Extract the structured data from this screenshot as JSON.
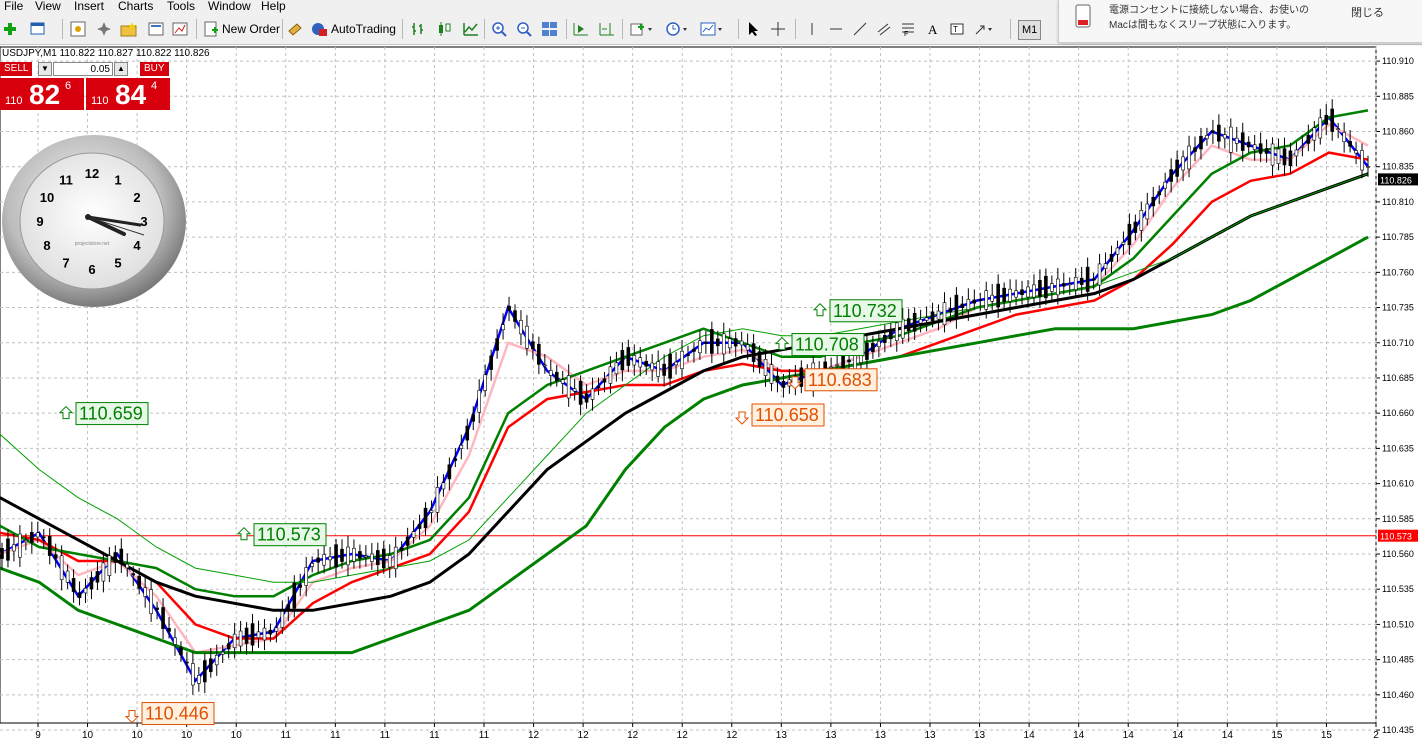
{
  "menu": [
    "File",
    "View",
    "Insert",
    "Charts",
    "Tools",
    "Window",
    "Help"
  ],
  "toolbar": {
    "new_order_label": "New Order",
    "autotrading_label": "AutoTrading",
    "timeframe_label": "M1"
  },
  "notification": {
    "line1": "電源コンセントに接続しない場合、お使いの",
    "line2": "Macは間もなくスリープ状態に入ります。",
    "close_label": "閉じる"
  },
  "chart": {
    "symbol_info": "USDJPY,M1  110.822 110.827 110.822 110.826",
    "current_price_label": "110.826",
    "hline_price_label": "110.573",
    "hline_color": "#ff0000"
  },
  "trade_panel": {
    "sell_label": "SELL",
    "buy_label": "BUY",
    "lot_value": "0.05",
    "sell_big_prefix": "110",
    "sell_big": "82",
    "sell_sup": "6",
    "buy_big_prefix": "110",
    "buy_big": "84",
    "buy_sup": "4"
  },
  "clock": {
    "numbers": [
      "12",
      "1",
      "2",
      "3",
      "4",
      "5",
      "6",
      "7",
      "8",
      "9",
      "10",
      "11"
    ],
    "brand": "projectstore.net"
  },
  "chart_data": {
    "type": "line",
    "ylim": [
      110.44,
      110.92
    ],
    "y_ticks": [
      "110.910",
      "110.885",
      "110.860",
      "110.835",
      "110.810",
      "110.785",
      "110.760",
      "110.735",
      "110.710",
      "110.685",
      "110.660",
      "110.635",
      "110.610",
      "110.585",
      "110.560",
      "110.535",
      "110.510",
      "110.485",
      "110.460",
      "110.435"
    ],
    "x_ticks": [
      "9",
      "10",
      "10",
      "10",
      "10",
      "11",
      "11",
      "11",
      "11",
      "11",
      "12",
      "12",
      "12",
      "12",
      "12",
      "13",
      "13",
      "13",
      "13",
      "13",
      "14",
      "14",
      "14",
      "14",
      "14",
      "15",
      "15",
      "2"
    ],
    "annotations": [
      {
        "label": "110.659",
        "price": 110.659,
        "color": "#008000",
        "direction": "up"
      },
      {
        "label": "110.446",
        "price": 110.446,
        "color": "#e05000",
        "direction": "down"
      },
      {
        "label": "110.573",
        "price": 110.573,
        "color": "#008000",
        "direction": "up"
      },
      {
        "label": "110.732",
        "price": 110.732,
        "color": "#008000",
        "direction": "up"
      },
      {
        "label": "110.708",
        "price": 110.708,
        "color": "#008000",
        "direction": "up"
      },
      {
        "label": "110.683",
        "price": 110.683,
        "color": "#e05000",
        "direction": "down"
      },
      {
        "label": "110.658",
        "price": 110.658,
        "color": "#e05000",
        "direction": "down"
      }
    ],
    "series": [
      {
        "color": "#0000ff",
        "values": [
          110.56,
          110.575,
          110.53,
          110.56,
          110.52,
          110.47,
          110.5,
          110.505,
          110.555,
          110.56,
          110.555,
          110.59,
          110.65,
          110.735,
          110.69,
          110.67,
          110.7,
          110.69,
          110.71,
          110.71,
          110.68,
          110.69,
          110.7,
          110.72,
          110.73,
          110.74,
          110.745,
          110.75,
          110.755,
          110.79,
          110.83,
          110.86,
          110.85,
          110.84,
          110.87,
          110.835
        ]
      },
      {
        "color": "#ffb6c1",
        "values": [
          110.56,
          110.57,
          110.545,
          110.555,
          110.53,
          110.49,
          110.495,
          110.5,
          110.54,
          110.55,
          110.555,
          110.58,
          110.63,
          110.71,
          110.7,
          110.68,
          110.69,
          110.69,
          110.7,
          110.705,
          110.69,
          110.69,
          110.7,
          110.71,
          110.72,
          110.735,
          110.74,
          110.745,
          110.75,
          110.78,
          110.82,
          110.85,
          110.84,
          110.84,
          110.865,
          110.85
        ]
      },
      {
        "color": "#ff0000",
        "values": [
          110.575,
          110.57,
          110.555,
          110.555,
          110.54,
          110.51,
          110.5,
          110.5,
          110.525,
          110.54,
          110.55,
          110.56,
          110.59,
          110.65,
          110.67,
          110.675,
          110.68,
          110.68,
          110.69,
          110.695,
          110.69,
          110.69,
          110.695,
          110.7,
          110.71,
          110.72,
          110.73,
          110.735,
          110.74,
          110.755,
          110.78,
          110.81,
          110.825,
          110.83,
          110.845,
          110.84
        ]
      },
      {
        "color": "#008000",
        "values": [
          110.58,
          110.565,
          110.56,
          110.555,
          110.55,
          110.535,
          110.53,
          110.53,
          110.545,
          110.555,
          110.56,
          110.57,
          110.6,
          110.66,
          110.68,
          110.69,
          110.7,
          110.71,
          110.72,
          110.71,
          110.7,
          110.7,
          110.71,
          110.715,
          110.725,
          110.735,
          110.74,
          110.745,
          110.75,
          110.77,
          110.8,
          110.83,
          110.845,
          110.85,
          110.87,
          110.875
        ]
      },
      {
        "color": "#000000",
        "values": [
          110.6,
          110.585,
          110.57,
          110.555,
          110.54,
          110.53,
          110.525,
          110.52,
          110.52,
          110.525,
          110.53,
          110.54,
          110.56,
          110.59,
          110.62,
          110.64,
          110.66,
          110.675,
          110.69,
          110.7,
          110.705,
          110.71,
          110.715,
          110.72,
          110.725,
          110.73,
          110.735,
          110.74,
          110.745,
          110.755,
          110.77,
          110.785,
          110.8,
          110.81,
          110.82,
          110.83
        ]
      },
      {
        "color": "#00a000",
        "values": [
          110.645,
          110.62,
          110.6,
          110.585,
          110.565,
          110.55,
          110.545,
          110.54,
          110.54,
          110.545,
          110.55,
          110.555,
          110.57,
          110.6,
          110.63,
          110.66,
          110.68,
          110.7,
          110.715,
          110.72,
          110.715,
          110.715,
          110.72,
          110.725,
          110.73,
          110.735,
          110.74,
          110.745,
          110.75,
          110.76,
          110.77,
          110.785,
          110.8,
          110.81,
          110.82,
          110.83
        ]
      },
      {
        "color": "#008000",
        "values": [
          110.55,
          110.54,
          110.52,
          110.51,
          110.5,
          110.49,
          110.49,
          110.49,
          110.49,
          110.49,
          110.5,
          110.51,
          110.52,
          110.54,
          110.56,
          110.58,
          110.62,
          110.65,
          110.67,
          110.68,
          110.685,
          110.69,
          110.695,
          110.7,
          110.705,
          110.71,
          110.715,
          110.72,
          110.72,
          110.72,
          110.725,
          110.73,
          110.74,
          110.755,
          110.77,
          110.785
        ]
      }
    ]
  }
}
